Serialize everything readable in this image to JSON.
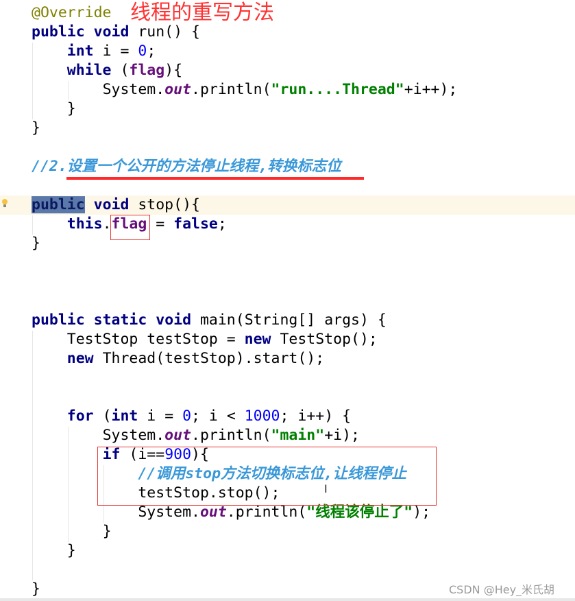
{
  "annotation_title": "线程的重写方法",
  "watermark": "CSDN @Hey_米氏胡",
  "colors": {
    "keyword": "#000080",
    "field": "#660e7a",
    "string": "#008000",
    "number": "#0000ff",
    "annotation": "#808000",
    "comment": "#3a98d8",
    "red_markup": "#ff3333"
  },
  "icons": {
    "bulb": "lightbulb-icon",
    "cursor": "text-cursor-icon"
  },
  "code_lines": [
    {
      "indent": 0,
      "tokens": [
        {
          "t": "@Override",
          "c": "ann"
        }
      ]
    },
    {
      "indent": 0,
      "tokens": [
        {
          "t": "public",
          "c": "kw"
        },
        {
          "t": " "
        },
        {
          "t": "void",
          "c": "kw"
        },
        {
          "t": " run() {"
        }
      ]
    },
    {
      "indent": 4,
      "tokens": [
        {
          "t": "int",
          "c": "kw"
        },
        {
          "t": " i = "
        },
        {
          "t": "0",
          "c": "num"
        },
        {
          "t": ";"
        }
      ]
    },
    {
      "indent": 4,
      "tokens": [
        {
          "t": "while",
          "c": "kw"
        },
        {
          "t": " ("
        },
        {
          "t": "flag",
          "c": "fld"
        },
        {
          "t": "){"
        }
      ]
    },
    {
      "indent": 8,
      "tokens": [
        {
          "t": "System."
        },
        {
          "t": "out",
          "c": "out"
        },
        {
          "t": ".println("
        },
        {
          "t": "\"run....Thread\"",
          "c": "str"
        },
        {
          "t": "+i++);"
        }
      ]
    },
    {
      "indent": 4,
      "tokens": [
        {
          "t": "}"
        }
      ]
    },
    {
      "indent": 0,
      "tokens": [
        {
          "t": "}"
        }
      ]
    },
    {
      "indent": 0,
      "tokens": []
    },
    {
      "indent": 0,
      "tokens": [
        {
          "t": "//2.设置一个公开的方法停止线程,转换标志位",
          "c": "cmt"
        }
      ]
    },
    {
      "indent": 0,
      "tokens": []
    },
    {
      "indent": 0,
      "highlight": true,
      "tokens": [
        {
          "t": "public",
          "c": "kw sel"
        },
        {
          "t": " "
        },
        {
          "t": "void",
          "c": "kw"
        },
        {
          "t": " stop(){"
        }
      ]
    },
    {
      "indent": 4,
      "tokens": [
        {
          "t": "this",
          "c": "kw"
        },
        {
          "t": "."
        },
        {
          "t": "flag",
          "c": "fld"
        },
        {
          "t": " = "
        },
        {
          "t": "false",
          "c": "kw"
        },
        {
          "t": ";"
        }
      ]
    },
    {
      "indent": 0,
      "tokens": [
        {
          "t": "}"
        }
      ]
    },
    {
      "indent": 0,
      "tokens": []
    },
    {
      "indent": 0,
      "tokens": []
    },
    {
      "indent": 0,
      "tokens": []
    },
    {
      "indent": 0,
      "tokens": [
        {
          "t": "public",
          "c": "kw"
        },
        {
          "t": " "
        },
        {
          "t": "static",
          "c": "kw"
        },
        {
          "t": " "
        },
        {
          "t": "void",
          "c": "kw"
        },
        {
          "t": " main(String[] args) {"
        }
      ]
    },
    {
      "indent": 4,
      "tokens": [
        {
          "t": "TestStop testStop = "
        },
        {
          "t": "new",
          "c": "kw"
        },
        {
          "t": " TestStop();"
        }
      ]
    },
    {
      "indent": 4,
      "tokens": [
        {
          "t": "new",
          "c": "kw"
        },
        {
          "t": " Thread(testStop).start();"
        }
      ]
    },
    {
      "indent": 0,
      "tokens": []
    },
    {
      "indent": 0,
      "tokens": []
    },
    {
      "indent": 4,
      "tokens": [
        {
          "t": "for",
          "c": "kw"
        },
        {
          "t": " ("
        },
        {
          "t": "int",
          "c": "kw"
        },
        {
          "t": " i = "
        },
        {
          "t": "0",
          "c": "num"
        },
        {
          "t": "; i < "
        },
        {
          "t": "1000",
          "c": "num"
        },
        {
          "t": "; i++) {"
        }
      ]
    },
    {
      "indent": 8,
      "tokens": [
        {
          "t": "System."
        },
        {
          "t": "out",
          "c": "out"
        },
        {
          "t": ".println("
        },
        {
          "t": "\"main\"",
          "c": "str"
        },
        {
          "t": "+i);"
        }
      ]
    },
    {
      "indent": 8,
      "tokens": [
        {
          "t": "if",
          "c": "kw"
        },
        {
          "t": " (i=="
        },
        {
          "t": "900",
          "c": "num"
        },
        {
          "t": "){"
        }
      ]
    },
    {
      "indent": 12,
      "tokens": [
        {
          "t": "//调用stop方法切换标志位,让线程停止",
          "c": "cmt"
        }
      ]
    },
    {
      "indent": 12,
      "tokens": [
        {
          "t": "testStop.stop();"
        }
      ]
    },
    {
      "indent": 12,
      "tokens": [
        {
          "t": "System."
        },
        {
          "t": "out",
          "c": "out"
        },
        {
          "t": ".println("
        },
        {
          "t": "\"线程该停止了\"",
          "c": "str"
        },
        {
          "t": ");"
        }
      ]
    },
    {
      "indent": 8,
      "tokens": [
        {
          "t": "}"
        }
      ]
    },
    {
      "indent": 4,
      "tokens": [
        {
          "t": "}"
        }
      ]
    },
    {
      "indent": 0,
      "tokens": []
    },
    {
      "indent": 0,
      "tokens": [
        {
          "t": "}"
        }
      ]
    }
  ]
}
